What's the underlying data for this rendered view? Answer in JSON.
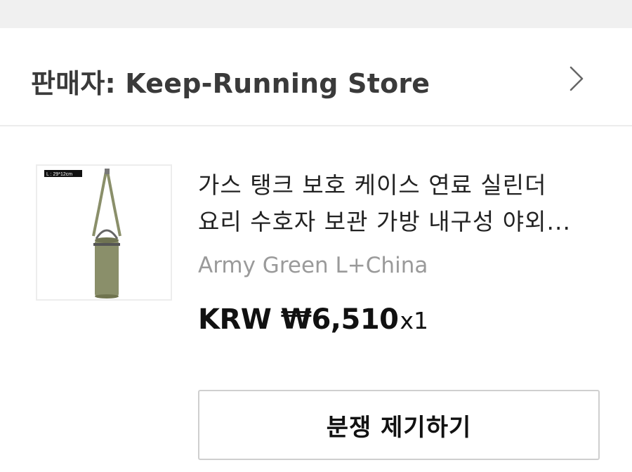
{
  "seller": {
    "label": "판매자: Keep-Running Store",
    "chevron_icon": "chevron-right-icon"
  },
  "product": {
    "image_label": "L : 29*12cm",
    "title_line1": "가스 탱크 보호 케이스 연료 실린더",
    "title_line2": "요리 수호자 보관 가방 내구성 야외...",
    "variant": "Army Green L+China",
    "price": "KRW ₩6,510",
    "quantity": "x1"
  },
  "actions": {
    "dispute_button": "분쟁 제기하기"
  },
  "colors": {
    "top_bar": "#f0f0f0",
    "divider": "#ececec",
    "bag_green": "#8a8f6a",
    "muted_text": "#9a9a9a"
  }
}
